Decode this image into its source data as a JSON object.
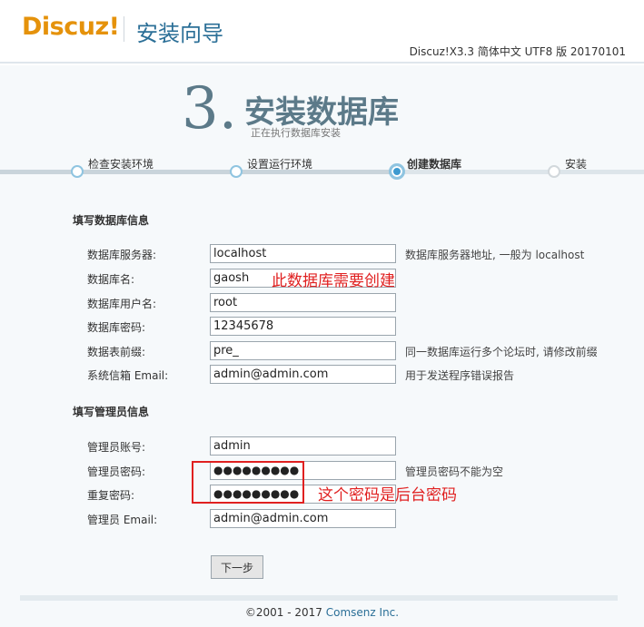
{
  "header": {
    "logo": "Discuz!",
    "title": "安装向导",
    "version": "Discuz!X3.3 简体中文 UTF8 版 20170101"
  },
  "step": {
    "number": "3.",
    "title": "安装数据库",
    "subtitle": "正在执行数据库安装"
  },
  "progress": {
    "steps": [
      "检查安装环境",
      "设置运行环境",
      "创建数据库",
      "安装"
    ],
    "current_index": 2
  },
  "db_section": {
    "title": "填写数据库信息",
    "rows": [
      {
        "label": "数据库服务器:",
        "value": "localhost",
        "hint": "数据库服务器地址, 一般为 localhost"
      },
      {
        "label": "数据库名:",
        "value": "gaosh",
        "hint": ""
      },
      {
        "label": "数据库用户名:",
        "value": "root",
        "hint": ""
      },
      {
        "label": "数据库密码:",
        "value": "12345678",
        "hint": ""
      },
      {
        "label": "数据表前缀:",
        "value": "pre_",
        "hint": "同一数据库运行多个论坛时, 请修改前缀"
      },
      {
        "label": "系统信箱 Email:",
        "value": "admin@admin.com",
        "hint": "用于发送程序错误报告"
      }
    ]
  },
  "admin_section": {
    "title": "填写管理员信息",
    "rows": [
      {
        "label": "管理员账号:",
        "value": "admin",
        "hint": ""
      },
      {
        "label": "管理员密码:",
        "value": "●●●●●●●●●",
        "hint": "管理员密码不能为空"
      },
      {
        "label": "重复密码:",
        "value": "●●●●●●●●●",
        "hint": ""
      },
      {
        "label": "管理员 Email:",
        "value": "admin@admin.com",
        "hint": ""
      }
    ]
  },
  "annotations": {
    "db_note": "此数据库需要创建",
    "pwd_note": "这个密码是后台密码",
    "color": "#e02020"
  },
  "buttons": {
    "next": "下一步"
  },
  "footer": {
    "copyright": "©2001 - 2017 ",
    "brand": "Comsenz Inc."
  }
}
